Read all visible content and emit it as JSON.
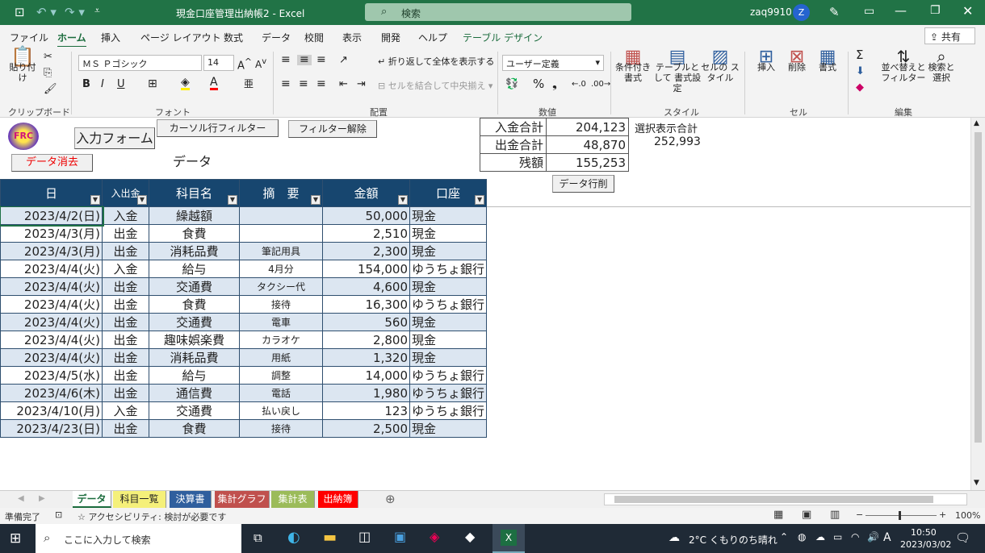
{
  "window": {
    "title": "現金口座管理出納帳2  -  Excel",
    "search": "検索",
    "user": "zaq9910",
    "avatar": "Z"
  },
  "menu": [
    "ファイル",
    "ホーム",
    "挿入",
    "ページ レイアウト",
    "数式",
    "データ",
    "校閲",
    "表示",
    "開発",
    "ヘルプ",
    "テーブル デザイン"
  ],
  "share": "共有",
  "ribbon": {
    "paste": "貼り付け",
    "font_name": "ＭＳ Ｐゴシック",
    "font_size": "14",
    "wrap": "折り返して全体を表示する",
    "merge": "セルを結合して中央揃え",
    "number_format": "ユーザー定義",
    "cond": "条件付き 書式",
    "table_fmt": "テーブルとして 書式設定",
    "cell_style": "セルの スタイル",
    "insert": "挿入",
    "delete": "削除",
    "format": "書式",
    "sort": "並べ替えと フィルター",
    "find": "検索と 選択",
    "groups": [
      "クリップボード",
      "フォント",
      "配置",
      "数値",
      "スタイル",
      "セル",
      "編集"
    ]
  },
  "sheet_buttons": {
    "input_form": "入力フォーム",
    "cursor_filter": "カーソル行フィルター",
    "filter_clear": "フィルター解除",
    "data_clear": "データ消去",
    "data_delete": "データ行削",
    "logo": "FRC",
    "caption": "データ"
  },
  "summary": [
    {
      "label": "入金合計",
      "value": "204,123"
    },
    {
      "label": "出金合計",
      "value": "48,870"
    },
    {
      "label": "残額",
      "value": "155,253"
    }
  ],
  "selection_label": "選択表示合計",
  "selection_value": "252,993",
  "table": {
    "headers": [
      "日",
      "入出金",
      "科目名",
      "摘　要",
      "金額",
      "口座"
    ],
    "rows": [
      [
        "2023/4/2(日)",
        "入金",
        "繰越額",
        "",
        "50,000",
        "現金"
      ],
      [
        "2023/4/3(月)",
        "出金",
        "食費",
        "",
        "2,510",
        "現金"
      ],
      [
        "2023/4/3(月)",
        "出金",
        "消耗品費",
        "筆記用具",
        "2,300",
        "現金"
      ],
      [
        "2023/4/4(火)",
        "入金",
        "給与",
        "4月分",
        "154,000",
        "ゆうちょ銀行"
      ],
      [
        "2023/4/4(火)",
        "出金",
        "交通費",
        "タクシー代",
        "4,600",
        "現金"
      ],
      [
        "2023/4/4(火)",
        "出金",
        "食費",
        "接待",
        "16,300",
        "ゆうちょ銀行"
      ],
      [
        "2023/4/4(火)",
        "出金",
        "交通費",
        "電車",
        "560",
        "現金"
      ],
      [
        "2023/4/4(火)",
        "出金",
        "趣味娯楽費",
        "カラオケ",
        "2,800",
        "現金"
      ],
      [
        "2023/4/4(火)",
        "出金",
        "消耗品費",
        "用紙",
        "1,320",
        "現金"
      ],
      [
        "2023/4/5(水)",
        "出金",
        "給与",
        "調整",
        "14,000",
        "ゆうちょ銀行"
      ],
      [
        "2023/4/6(木)",
        "出金",
        "通信費",
        "電話",
        "1,980",
        "ゆうちょ銀行"
      ],
      [
        "2023/4/10(月)",
        "入金",
        "交通費",
        "払い戻し",
        "123",
        "ゆうちょ銀行"
      ],
      [
        "2023/4/23(日)",
        "出金",
        "食費",
        "接待",
        "2,500",
        "現金"
      ]
    ]
  },
  "tabs": [
    {
      "label": "データ",
      "color": "#ffffff"
    },
    {
      "label": "科目一覧",
      "color": "#f5f07a"
    },
    {
      "label": "決算書",
      "color": "#2f5f9e"
    },
    {
      "label": "集計グラフ",
      "color": "#c0504d"
    },
    {
      "label": "集計表",
      "color": "#9bbb59"
    },
    {
      "label": "出納簿",
      "color": "#ff0000"
    }
  ],
  "status": {
    "ready": "準備完了",
    "access": "アクセシビリティ: 検討が必要です",
    "zoom": "100%"
  },
  "taskbar": {
    "search": "ここに入力して検索",
    "weather": "2°C くもりのち晴れ",
    "time": "10:50",
    "date": "2023/03/02",
    "ime": "A"
  }
}
